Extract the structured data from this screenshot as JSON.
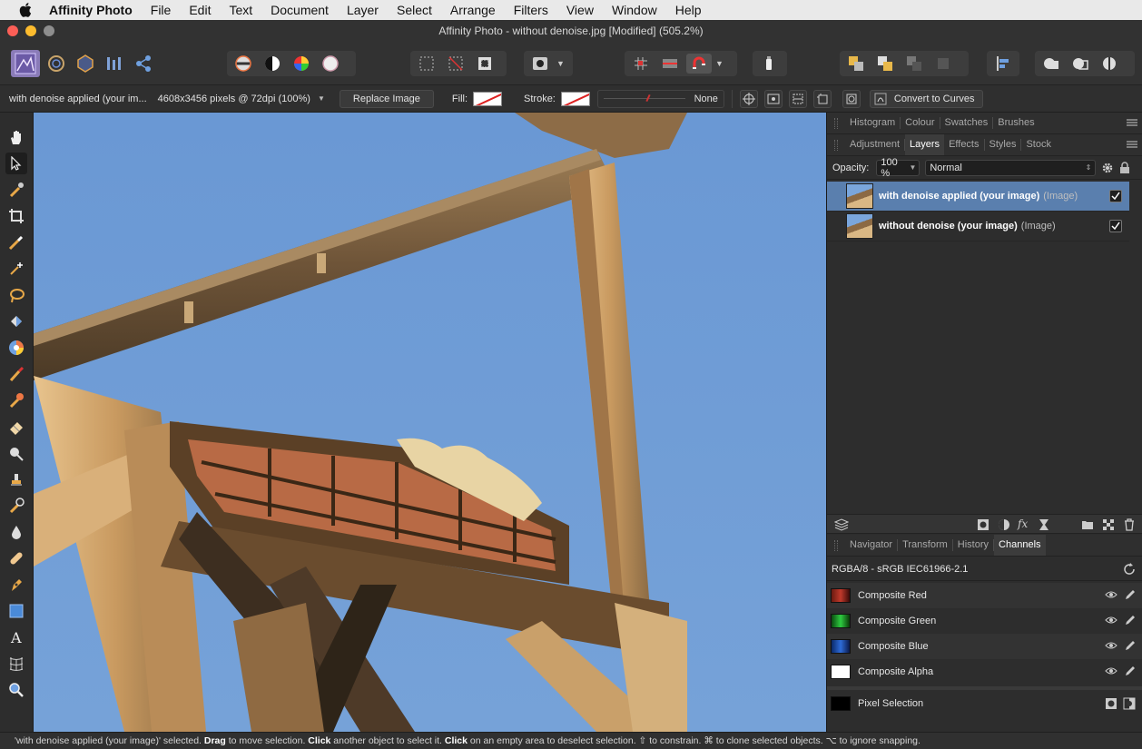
{
  "menubar": {
    "app": "Affinity Photo",
    "items": [
      "File",
      "Edit",
      "Text",
      "Document",
      "Layer",
      "Select",
      "Arrange",
      "Filters",
      "View",
      "Window",
      "Help"
    ]
  },
  "window": {
    "title": "Affinity Photo - without denoise.jpg [Modified] (505.2%)"
  },
  "context": {
    "selection_name": "with denoise applied (your im...",
    "dimensions": "4608x3456 pixels @ 72dpi (100%)",
    "replace_image": "Replace Image",
    "fill_label": "Fill:",
    "stroke_label": "Stroke:",
    "stroke_value": "None",
    "convert_to_curves": "Convert to Curves"
  },
  "panels": {
    "top_tabs": [
      "Histogram",
      "Colour",
      "Swatches",
      "Brushes"
    ],
    "layer_tabs": [
      "Adjustment",
      "Layers",
      "Effects",
      "Styles",
      "Stock"
    ],
    "layer_active_tab": "Layers",
    "opacity_label": "Opacity:",
    "opacity_value": "100 %",
    "blend_mode": "Normal",
    "layers": [
      {
        "name": "with denoise applied (your image)",
        "kind": "(Image)",
        "selected": true,
        "visible": true
      },
      {
        "name": "without denoise (your image)",
        "kind": "(Image)",
        "selected": false,
        "visible": true
      }
    ],
    "bottom_tabs": [
      "Navigator",
      "Transform",
      "History",
      "Channels"
    ],
    "bottom_active_tab": "Channels",
    "color_profile": "RGBA/8 - sRGB IEC61966-2.1",
    "channels": [
      {
        "name": "Composite Red",
        "color": "#c0392b"
      },
      {
        "name": "Composite Green",
        "color": "#2ecc40"
      },
      {
        "name": "Composite Blue",
        "color": "#2e6bd8"
      },
      {
        "name": "Composite Alpha",
        "color": "#ffffff"
      }
    ],
    "pixel_selection": "Pixel Selection"
  },
  "status": {
    "quoted": "'with denoise applied (your image)' selected. ",
    "drag": "Drag",
    "t1": " to move selection. ",
    "click1": "Click",
    "t2": " another object to select it. ",
    "click2": "Click",
    "t3": " on an empty area to deselect selection. ⇧ to constrain. ⌘ to clone selected objects. ⌥ to ignore snapping."
  },
  "colors": {
    "accent_selection": "#5a7fae",
    "sky": "#6e9bd6",
    "close": "#fc5f57",
    "minimize": "#fdbc2e",
    "zoom": "#8e8e8e"
  }
}
